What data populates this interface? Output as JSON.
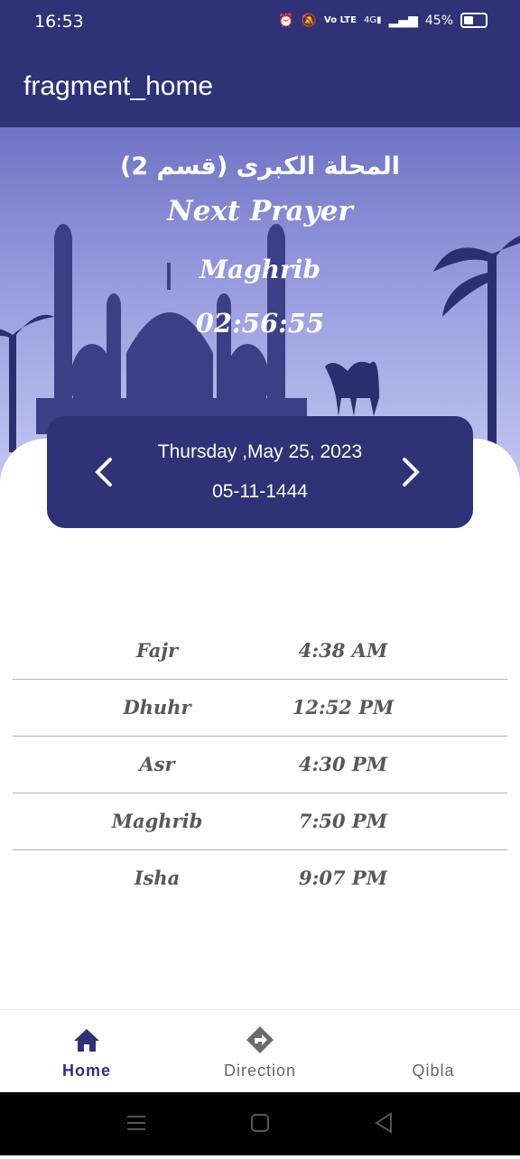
{
  "status_bar": {
    "time": "16:53",
    "battery": "45%"
  },
  "app_bar": {
    "title": "fragment_home"
  },
  "hero": {
    "city": "المحلة الكبرى (قسم 2)",
    "next_label": "Next Prayer",
    "next_prayer": "Maghrib",
    "countdown": "02:56:55"
  },
  "date_card": {
    "gregorian": "Thursday ,May 25, 2023",
    "hijri": "05-11-1444"
  },
  "prayers": [
    {
      "name": "Fajr",
      "time": "4:38 AM"
    },
    {
      "name": "Dhuhr",
      "time": "12:52 PM"
    },
    {
      "name": "Asr",
      "time": "4:30 PM"
    },
    {
      "name": "Maghrib",
      "time": "7:50 PM"
    },
    {
      "name": "Isha",
      "time": "9:07 PM"
    }
  ],
  "bottom_nav": {
    "items": [
      {
        "label": "Home",
        "icon": "home-icon",
        "active": true
      },
      {
        "label": "Direction",
        "icon": "direction-icon",
        "active": false
      },
      {
        "label": "Qibla",
        "icon": "qibla-icon",
        "active": false
      }
    ]
  },
  "colors": {
    "primary": "#2f3276",
    "text_gray": "#585858",
    "hero_sky": "#9a9fe0"
  }
}
